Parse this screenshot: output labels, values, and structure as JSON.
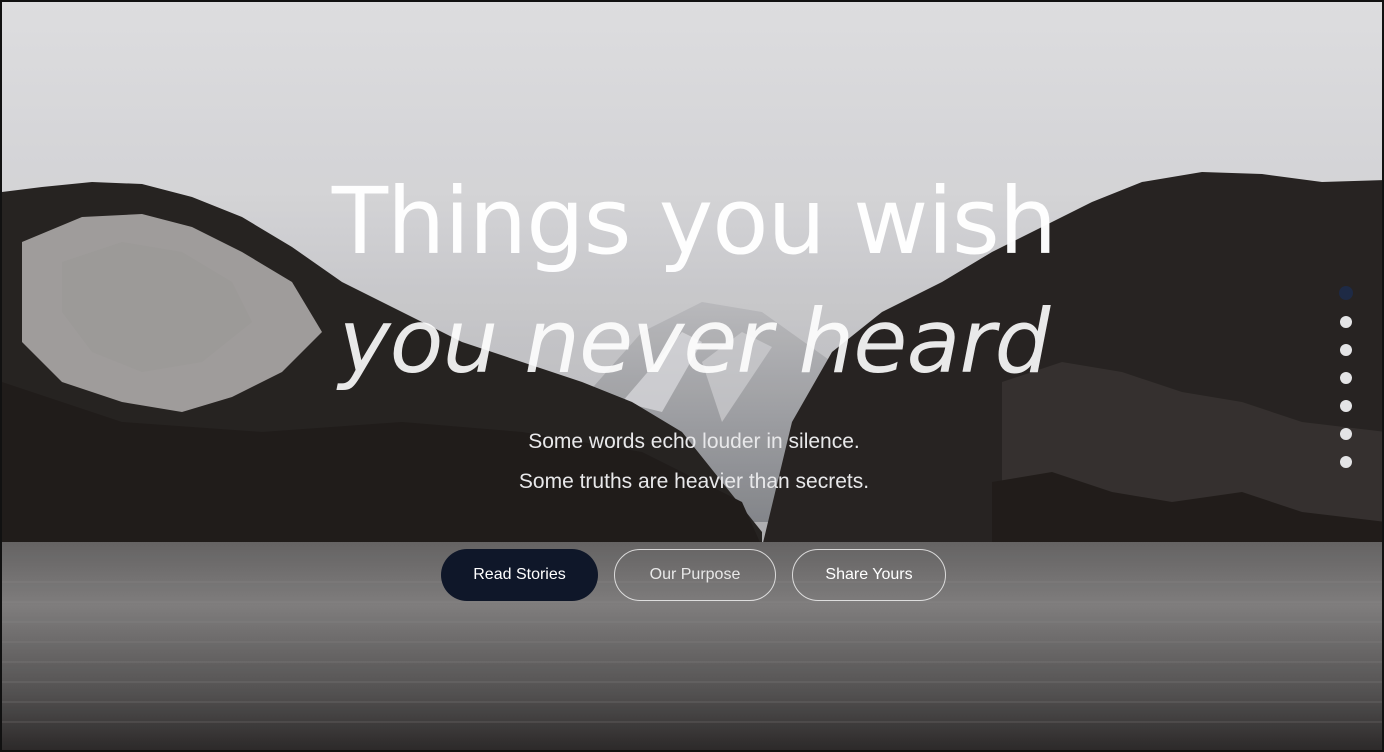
{
  "hero": {
    "headline_line1": "Things you wish",
    "headline_line2": "you never heard",
    "subtitle_line1": "Some words echo louder in silence.",
    "subtitle_line2": "Some truths are heavier than secrets."
  },
  "actions": {
    "read_stories": "Read Stories",
    "our_purpose": "Our Purpose",
    "share_yours": "Share Yours"
  },
  "slider": {
    "total_slides": 7,
    "active_index": 0
  },
  "colors": {
    "primary_button": "#0f1729",
    "active_dot": "#1e2a45",
    "text": "#ffffff"
  },
  "background_image": "mountain-lake-landscape"
}
